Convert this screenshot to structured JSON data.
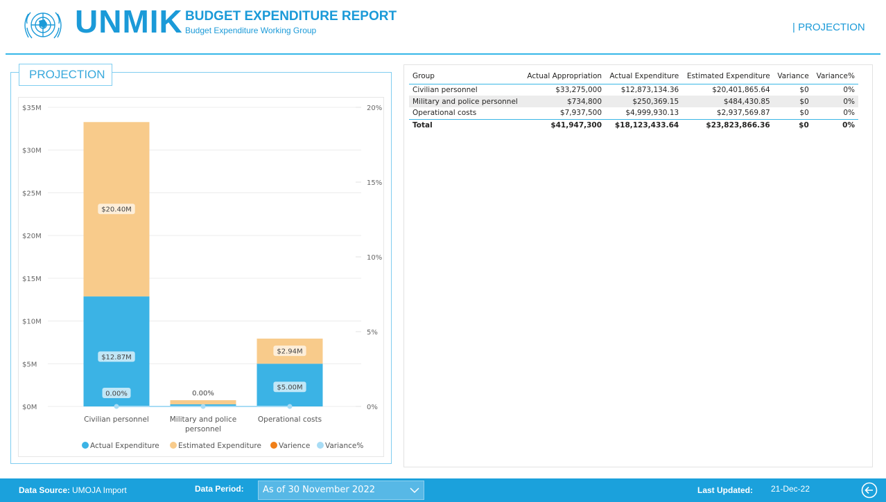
{
  "header": {
    "brand": "UNMIK",
    "report_title": "BUDGET EXPENDITURE REPORT",
    "report_subtitle": "Budget Expenditure Working Group",
    "page_tag": "| PROJECTION"
  },
  "section": {
    "title": "PROJECTION"
  },
  "colors": {
    "accent": "#1b9ad8",
    "actual": "#3bb3e5",
    "estimated": "#f8cb8b",
    "varience": "#f07f18",
    "variance_pct": "#a8dcf5"
  },
  "chart_data": {
    "type": "bar",
    "stacked": true,
    "categories": [
      [
        "Civilian personnel"
      ],
      [
        "Military and police",
        "personnel"
      ],
      [
        "Operational costs"
      ]
    ],
    "series": [
      {
        "name": "Actual Expenditure",
        "values": [
          12.873134,
          0.250369,
          4.99993
        ],
        "labels": [
          "$12.87M",
          "",
          "$5.00M"
        ]
      },
      {
        "name": "Estimated Expenditure",
        "values": [
          20.401866,
          0.484431,
          2.93757
        ],
        "labels": [
          "$20.40M",
          "",
          "$2.94M"
        ]
      },
      {
        "name": "Varience",
        "values": [
          0,
          0,
          0
        ]
      },
      {
        "name": "Variance%",
        "axis": "secondary",
        "values": [
          0,
          0,
          0
        ],
        "labels": [
          "0.00%",
          "0.00%",
          ""
        ]
      }
    ],
    "y_ticks": [
      "$0M",
      "$5M",
      "$10M",
      "$15M",
      "$20M",
      "$25M",
      "$30M",
      "$35M"
    ],
    "ylim": [
      0,
      35
    ],
    "y2_ticks": [
      "0%",
      "5%",
      "10%",
      "15%",
      "20%"
    ],
    "y2lim": [
      0,
      20
    ],
    "grid": true,
    "legend_position": "bottom"
  },
  "table": {
    "headers": [
      "Group",
      "Actual Appropriation",
      "Actual Expenditure",
      "Estimated Expenditure",
      "Variance",
      "Variance%"
    ],
    "rows": [
      [
        "Civilian personnel",
        "$33,275,000",
        "$12,873,134.36",
        "$20,401,865.64",
        "$0",
        "0%"
      ],
      [
        "Military and police personnel",
        "$734,800",
        "$250,369.15",
        "$484,430.85",
        "$0",
        "0%"
      ],
      [
        "Operational costs",
        "$7,937,500",
        "$4,999,930.13",
        "$2,937,569.87",
        "$0",
        "0%"
      ]
    ],
    "total": [
      "Total",
      "$41,947,300",
      "$18,123,433.64",
      "$23,823,866.36",
      "$0",
      "0%"
    ]
  },
  "footer": {
    "source_label": "Data Source:",
    "source_value": "UMOJA Import",
    "period_label": "Data Period:",
    "period_value": "As of 30 November 2022",
    "updated_label": "Last Updated:",
    "updated_value": "21-Dec-22"
  }
}
